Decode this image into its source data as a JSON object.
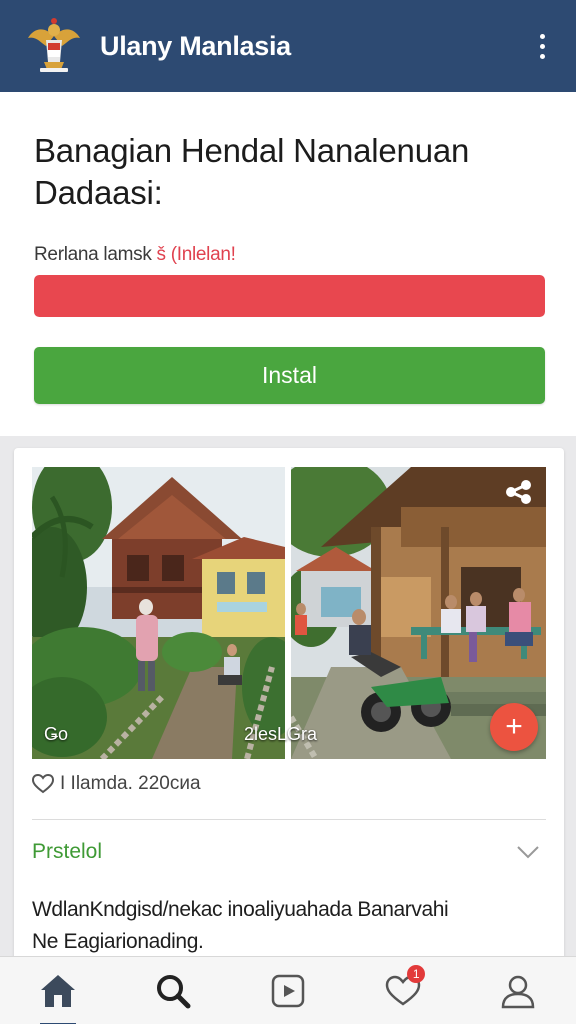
{
  "header": {
    "title": "Ulany Manlasia",
    "emblem_icon": "garuda-emblem-icon",
    "menu_icon": "kebab-menu-icon",
    "bar_color": "#2d4a72"
  },
  "install_card": {
    "heading_line1": "Banagian Hendal Nanalenuan",
    "heading_line2": "Dadaasi:",
    "subtitle_main": "Rerlana lamsk",
    "subtitle_accent": "š (Inlelan!",
    "progress_fraction": 1.0,
    "progress_color": "#e8474f",
    "install_label": "Instal",
    "install_color": "#4aa63f"
  },
  "post": {
    "photo_left_caption": "Ǥο",
    "photo_right_caption": "2lesLGra",
    "share_icon": "share-icon",
    "fab_icon": "plus-icon",
    "fab_color": "#ec5340",
    "meta_icon": "heart-outline-icon",
    "meta_text": "I Ilamda. 220сиа",
    "details_label": "Prstelol",
    "details_chevron": "chevron-down-icon",
    "details_line1": "WdlanKndgisd/nekac inoaliyuahada Banarvahi",
    "details_line2": "Ne Eagiarionading."
  },
  "bottom_nav": {
    "items": [
      {
        "icon": "home-icon",
        "active": true
      },
      {
        "icon": "search-icon",
        "active": false
      },
      {
        "icon": "video-icon",
        "active": false
      },
      {
        "icon": "heart-icon",
        "active": false,
        "badge": "1"
      },
      {
        "icon": "profile-icon",
        "active": false
      }
    ],
    "notification_badge": "1"
  }
}
